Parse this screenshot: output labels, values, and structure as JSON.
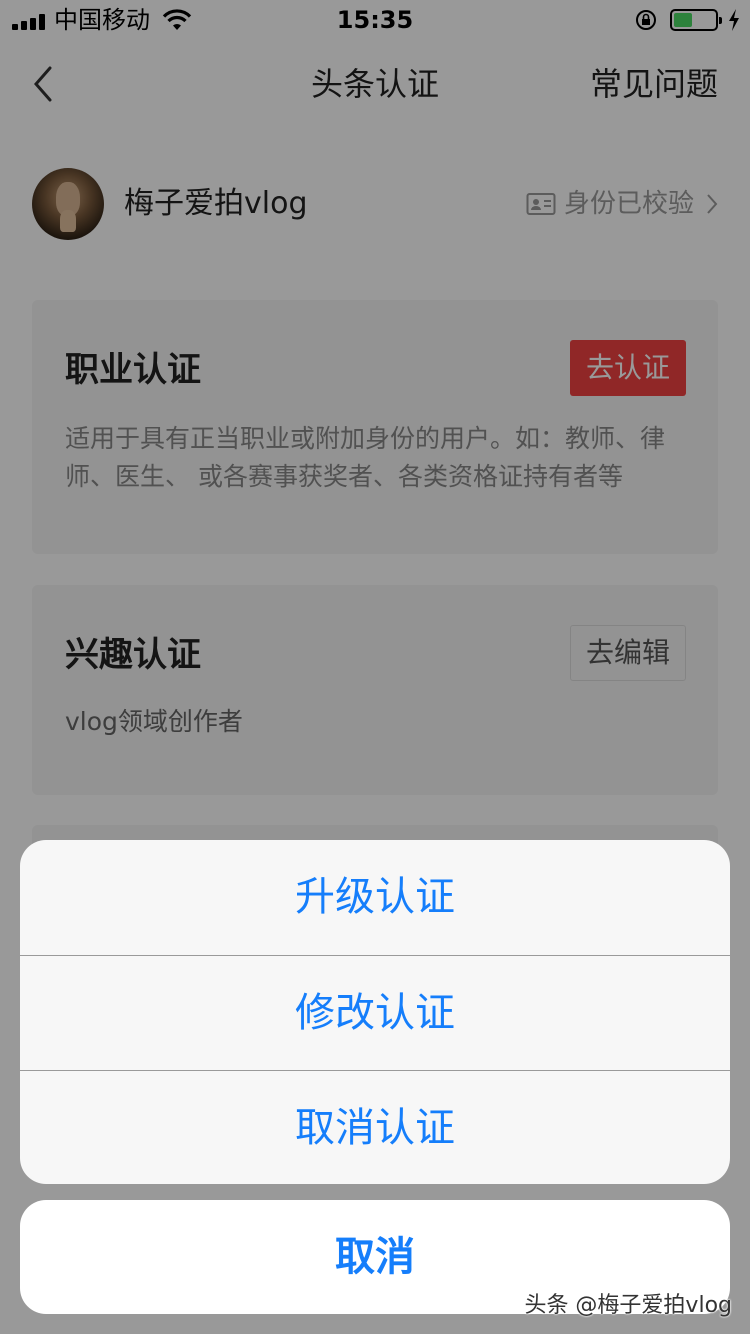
{
  "status_bar": {
    "carrier": "中国移动",
    "time": "15:35",
    "battery_level": 0.45,
    "battery_color": "#4cd964"
  },
  "nav": {
    "title": "头条认证",
    "faq_label": "常见问题",
    "back_icon": "chevron-left-icon"
  },
  "profile": {
    "username": "梅子爱拍vlog",
    "verified_label": "身份已校验",
    "verified_icon": "id-card-icon"
  },
  "cards": [
    {
      "title": "职业认证",
      "button_label": "去认证",
      "description": "适用于具有正当职业或附加身份的用户。如：教师、律师、医生、 或各赛事获奖者、各类资格证持有者等"
    },
    {
      "title": "兴趣认证",
      "button_label": "去编辑",
      "description": "vlog领域创作者"
    }
  ],
  "action_sheet": {
    "items": [
      "升级认证",
      "修改认证",
      "取消认证"
    ],
    "cancel_label": "取消",
    "accent_color": "#157efb"
  },
  "watermark": "头条 @梅子爱拍vlog"
}
